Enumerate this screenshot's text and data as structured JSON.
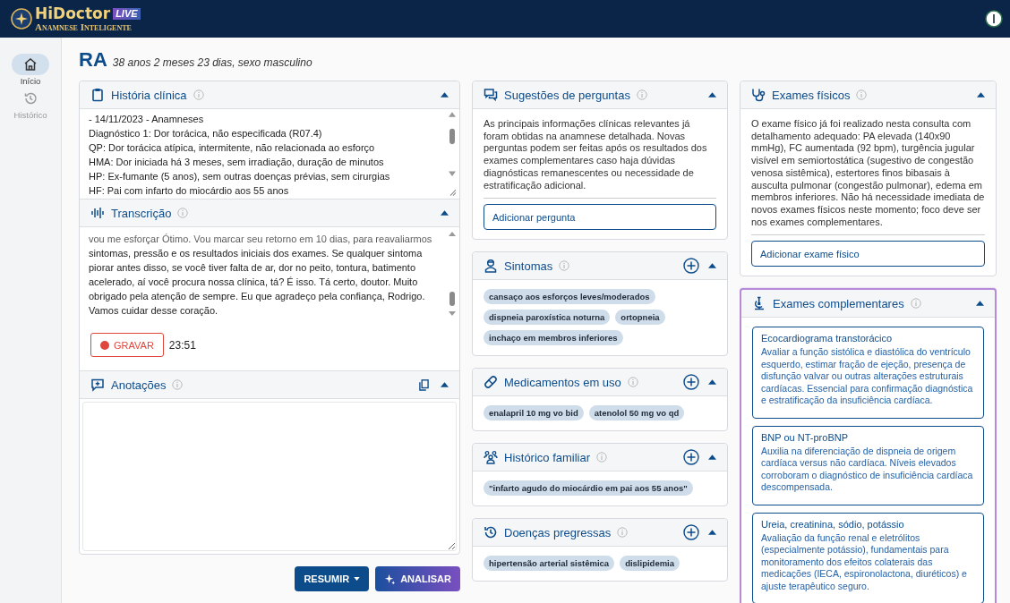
{
  "app": {
    "brand": "HiDoctor",
    "badge": "LIVE",
    "tagline": "Anamnese Inteligente"
  },
  "sidebar": {
    "items": [
      {
        "label": "Início",
        "selected": true
      },
      {
        "label": "Histórico",
        "selected": false
      }
    ]
  },
  "patient": {
    "initials": "RA",
    "details": "38 anos 2 meses 23 dias, sexo masculino"
  },
  "history": {
    "title": "História clínica",
    "lines": [
      "- 14/11/2023 - Anamneses",
      "Diagnóstico 1: Dor torácica, não especificada (R07.4)",
      "QP: Dor torácica atípica, intermitente, não relacionada ao esforço",
      "HMA: Dor iniciada há 3 meses, sem irradiação, duração de minutos",
      "HP: Ex-fumante (5 anos), sem outras doenças prévias, sem cirurgias",
      "HF: Pai com infarto do miocárdio aos 55 anos"
    ]
  },
  "transcription": {
    "title": "Transcrição",
    "text": "vou me esforçar Ótimo. Vou marcar seu retorno em 10 dias, para reavaliarmos sintomas, pressão e os resultados iniciais dos exames. Se qualquer sintoma piorar antes disso, se você tiver falta de ar, dor no peito, tontura, batimento acelerado, aí você procura nossa clínica, tá? É isso. Tá certo, doutor. Muito obrigado pela atenção de sempre. Eu que agradeço pela confiança, Rodrigo. Vamos cuidar desse coração.",
    "record_button": "GRAVAR",
    "elapsed": "23:51"
  },
  "notes": {
    "title": "Anotações"
  },
  "actions": {
    "summarize": "RESUMIR",
    "analyze": "ANALISAR"
  },
  "middle_panels": [
    {
      "kind": "suggestions",
      "title": "Sugestões de perguntas",
      "text": "As principais informações clínicas relevantes já foram obtidas na anamnese detalhada. Novas perguntas podem ser feitas após os resultados dos exames complementares caso haja dúvidas diagnósticas remanescentes ou necessidade de estratificação adicional.",
      "add_button": "Adicionar pergunta"
    },
    {
      "kind": "tags",
      "title": "Sintomas",
      "tags": [
        "cansaço aos esforços leves/moderados",
        "dispneia paroxística noturna",
        "ortopneia",
        "inchaço em membros inferiores"
      ]
    },
    {
      "kind": "tags",
      "title": "Medicamentos em uso",
      "tags": [
        "enalapril 10 mg vo bid",
        "atenolol 50 mg vo qd"
      ]
    },
    {
      "kind": "tags",
      "title": "Histórico familiar",
      "tags": [
        "\"infarto agudo do miocárdio em pai aos 55 anos\""
      ]
    },
    {
      "kind": "tags",
      "title": "Doenças pregressas",
      "tags": [
        "hipertensão arterial sistêmica",
        "dislipidemia"
      ]
    }
  ],
  "physical_exams": {
    "title": "Exames físicos",
    "text": "O exame físico já foi realizado nesta consulta com detalhamento adequado: PA elevada (140x90 mmHg), FC aumentada (92 bpm), turgência jugular visível em semiortostática (sugestivo de congestão venosa sistêmica), estertores finos bibasais à ausculta pulmonar (congestão pulmonar), edema em membros inferiores. Não há necessidade imediata de novos exames físicos neste momento; foco deve ser nos exames complementares.",
    "add_button": "Adicionar exame físico"
  },
  "complementary_exams": {
    "title": "Exames complementares",
    "highlighted": true,
    "items": [
      {
        "name": "Ecocardiograma transtorácico",
        "description": "Avaliar a função sistólica e diastólica do ventrículo esquerdo, estimar fração de ejeção, presença de disfunção valvar ou outras alterações estruturais cardíacas. Essencial para confirmação diagnóstica e estratificação da insuficiência cardíaca."
      },
      {
        "name": "BNP ou NT-proBNP",
        "description": "Auxilia na diferenciação de dispneia de origem cardíaca versus não cardíaca. Níveis elevados corroboram o diagnóstico de insuficiência cardíaca descompensada."
      },
      {
        "name": "Ureia, creatinina, sódio, potássio",
        "description": "Avaliação da função renal e eletrólitos (especialmente potássio), fundamentais para monitoramento dos efeitos colaterais das medicações (IECA, espironolactona, diuréticos) e ajuste terapêutico seguro."
      }
    ]
  }
}
